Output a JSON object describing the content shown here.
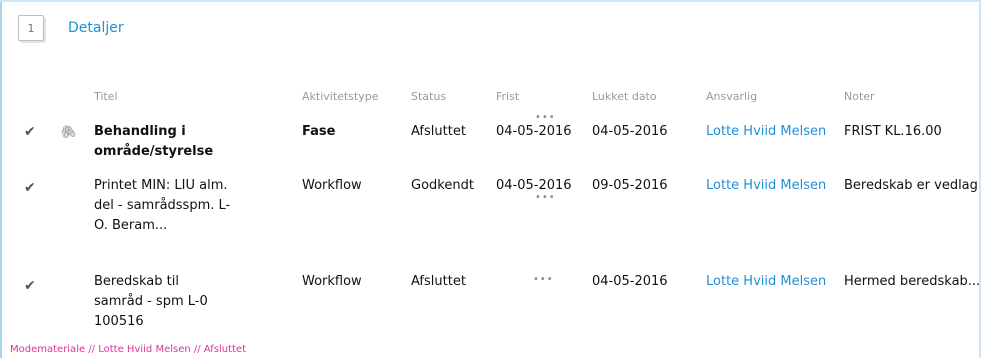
{
  "section": {
    "number": "1",
    "title": "Detaljer"
  },
  "columns": {
    "title": "Titel",
    "activity_type": "Aktivitetstype",
    "status": "Status",
    "deadline": "Frist",
    "closed_date": "Lukket dato",
    "responsible": "Ansvarlig",
    "notes": "Noter"
  },
  "rows": [
    {
      "title": "Behandling i område/styrelse",
      "activity_type": "Fase",
      "status": "Afsluttet",
      "deadline": "04-05-2016",
      "closed_date": "04-05-2016",
      "responsible": "Lotte Hviid Melsen",
      "notes": "FRIST KL.16.00"
    },
    {
      "title": "Printet MIN: LIU alm. del - samrådsspm. L-O. Beram...",
      "activity_type": "Workflow",
      "status": "Godkendt",
      "deadline": "04-05-2016",
      "closed_date": "09-05-2016",
      "responsible": "Lotte Hviid Melsen",
      "notes": "Beredskab er vedlag"
    },
    {
      "title": "Beredskab til samråd - spm L-0 100516",
      "activity_type": "Workflow",
      "status": "Afsluttet",
      "deadline": "",
      "closed_date": "04-05-2016",
      "responsible": "Lotte Hviid Melsen",
      "notes": "Hermed beredskab..."
    }
  ],
  "footer": "Modemateriale // Lotte Hviid Melsen // Afsluttet"
}
